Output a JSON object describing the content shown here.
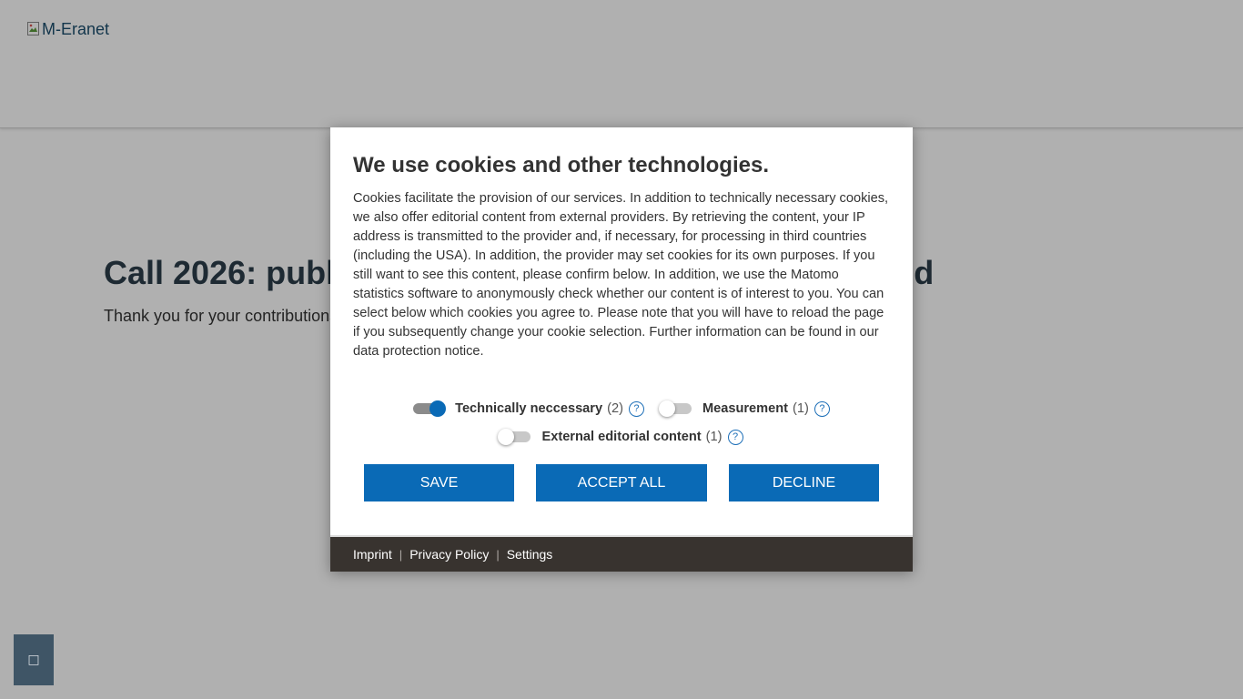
{
  "header": {
    "logo_alt": "M-Eranet"
  },
  "main": {
    "title": "Call 2026: public consultation on call topics is closed",
    "subtitle": "Thank you for your contributions."
  },
  "floating_button": {
    "icon": "chat-icon",
    "glyph": "□"
  },
  "cookie_modal": {
    "title": "We use cookies and other technologies.",
    "text": "Cookies facilitate the provision of our services. In addition to technically necessary cookies, we also offer editorial content from external providers. By retrieving the content, your IP address is transmitted to the provider and, if necessary, for processing in third countries (including the USA). In addition, the provider may set cookies for its own purposes. If you still want to see this content, please confirm below. In addition, we use the Matomo statistics software to anonymously check whether our content is of interest to you. You can select below which cookies you agree to. Please note that you will have to reload the page if you subsequently change your cookie selection. Further information can be found in our data protection notice.",
    "toggles": [
      {
        "label": "Technically neccessary",
        "count": "(2)",
        "enabled": true
      },
      {
        "label": "Measurement",
        "count": "(1)",
        "enabled": false
      },
      {
        "label": "External editorial content",
        "count": "(1)",
        "enabled": false
      }
    ],
    "help_glyph": "?",
    "buttons": {
      "save": "SAVE",
      "accept_all": "ACCEPT ALL",
      "decline": "DECLINE"
    },
    "footer": {
      "imprint": "Imprint",
      "privacy": "Privacy Policy",
      "settings": "Settings",
      "separator": "|"
    }
  },
  "colors": {
    "primary": "#0a6ab6",
    "footer_bg": "#38332f",
    "overlay": "rgba(0,0,0,0.31)"
  }
}
